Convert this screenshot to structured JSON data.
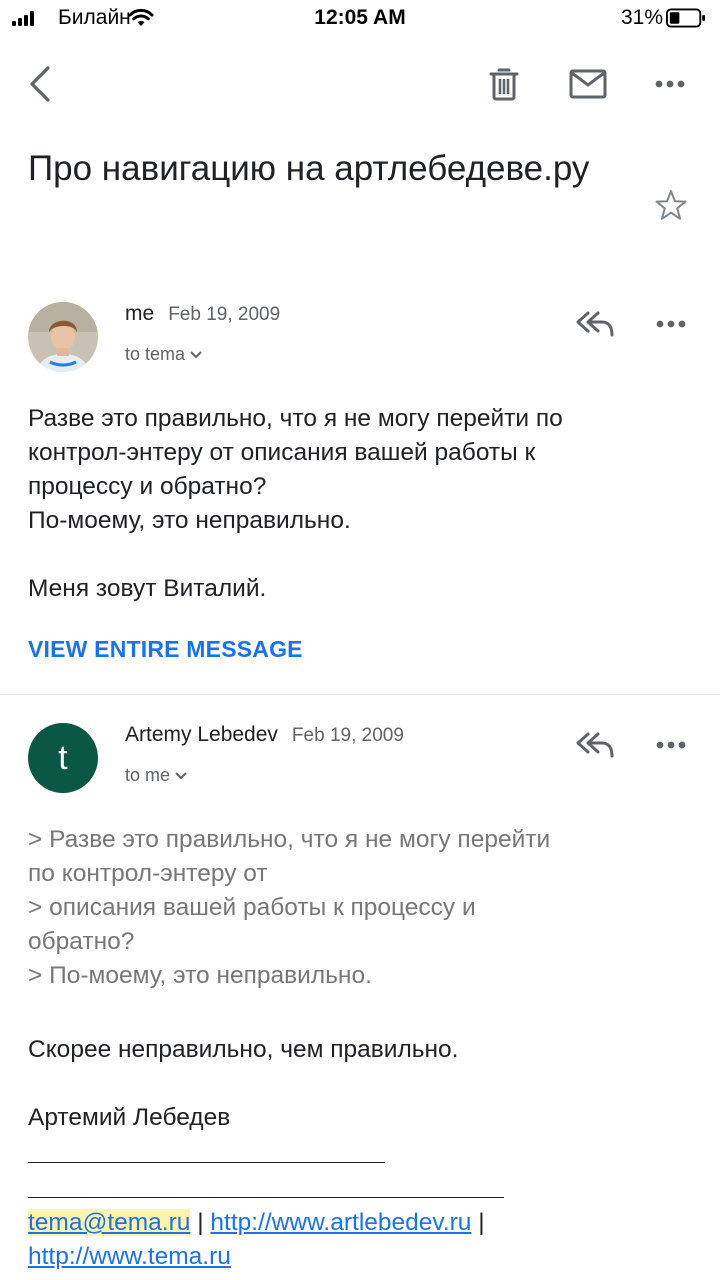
{
  "status_bar": {
    "carrier": "Билайн",
    "time": "12:05 AM",
    "battery": "31%"
  },
  "toolbar": {
    "back_icon": "chevron-left-icon",
    "delete_icon": "trash-icon",
    "mark_unread_icon": "mail-icon",
    "more_icon": "more-horizontal-icon"
  },
  "subject": "Про навигацию на артлебедеве.ру",
  "messages": [
    {
      "sender": "me",
      "date": "Feb 19, 2009",
      "to": "to tema",
      "body": "Разве это правильно, что я не могу перейти по\nконтрол-энтеру от описания вашей работы к\nпроцессу и обратно?\nПо-моему, это неправильно.\n\nМеня зовут Виталий.",
      "view_entire": "VIEW ENTIRE MESSAGE"
    },
    {
      "sender": "Artemy Lebedev",
      "avatar_letter": "t",
      "avatar_color": "#0b5745",
      "date": "Feb 19, 2009",
      "to": "to me",
      "quoted": "> Разве это правильно, что я не могу перейти\nпо контрол-энтеру от\n> описания вашей работы к процессу и\nобратно?\n> По-моему, это неправильно.",
      "reply": "Скорее неправильно, чем правильно.",
      "signature_name": "Артемий Лебедев",
      "links": {
        "email": "tema@tema.ru",
        "site1": "http://www.artlebedev.ru",
        "site2": "http://www.tema.ru",
        "separator": "|"
      }
    }
  ],
  "colors": {
    "accent": "#1a73e8",
    "icon_gray": "#5f6368"
  }
}
